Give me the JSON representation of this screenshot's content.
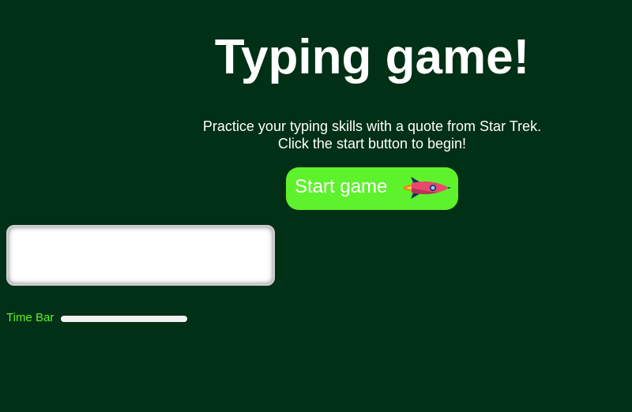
{
  "header": {
    "title": "Typing game!"
  },
  "intro": {
    "line1": "Practice your typing skills with a quote from Star Trek.",
    "line2": "Click the start button to begin!"
  },
  "start_button": {
    "label": "Start game",
    "icon": "rocket-icon"
  },
  "typing_input": {
    "value": "",
    "placeholder": ""
  },
  "time_bar": {
    "label": "Time Bar",
    "progress_percent": 100
  },
  "colors": {
    "background": "#003015",
    "accent_green": "#5ef22c",
    "text": "#ffffff"
  }
}
